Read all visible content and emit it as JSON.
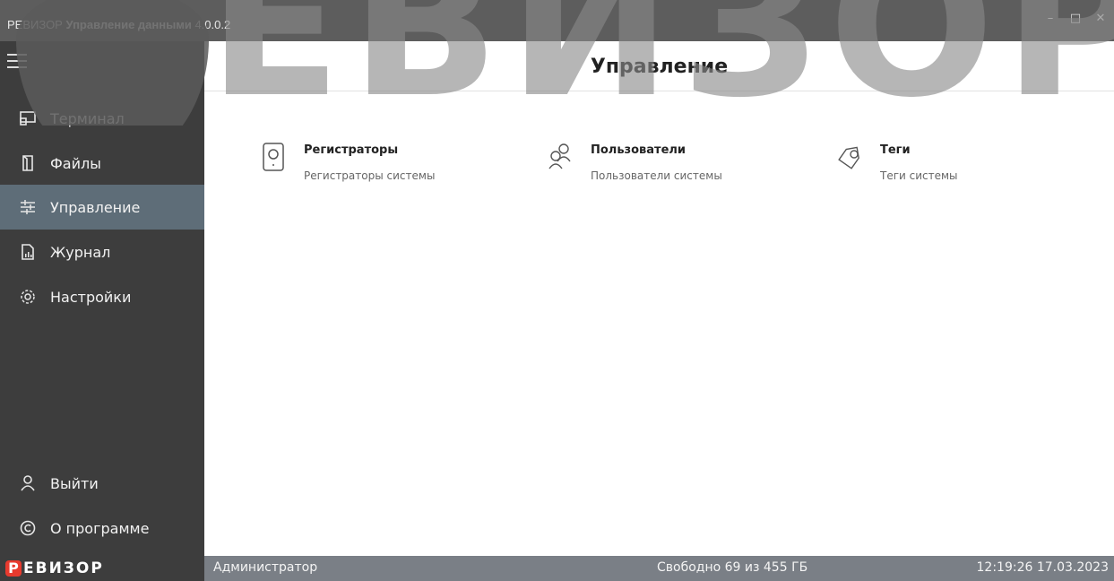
{
  "window": {
    "title_prefix": "РЕВИЗОР",
    "title_main": "Управление данными",
    "version": "4.0.0.2",
    "controls": {
      "minimize": "–",
      "maximize": "□",
      "close": "✕"
    }
  },
  "watermark": {
    "text": "ЕВИЗОР"
  },
  "sidebar": {
    "menu_icon": "hamburger-icon",
    "items": [
      {
        "label": "Терминал",
        "icon": "monitor-icon",
        "active": false
      },
      {
        "label": "Файлы",
        "icon": "file-icon",
        "active": false
      },
      {
        "label": "Управление",
        "icon": "sliders-icon",
        "active": true
      },
      {
        "label": "Журнал",
        "icon": "chart-file-icon",
        "active": false
      },
      {
        "label": "Настройки",
        "icon": "gear-icon",
        "active": false
      }
    ],
    "bottom_items": [
      {
        "label": "Выйти",
        "icon": "user-icon"
      },
      {
        "label": "О программе",
        "icon": "copyright-icon"
      }
    ]
  },
  "header": {
    "title": "Управление"
  },
  "cards": [
    {
      "title": "Регистраторы",
      "subtitle": "Регистраторы системы",
      "icon": "recorder-icon"
    },
    {
      "title": "Пользователи",
      "subtitle": "Пользователи системы",
      "icon": "users-icon"
    },
    {
      "title": "Теги",
      "subtitle": "Теги системы",
      "icon": "tag-icon"
    }
  ],
  "statusbar": {
    "brand_letter": "Р",
    "brand_rest": "ЕВИЗОР",
    "user": "Администратор",
    "free_space": "Свободно 69 из 455 ГБ",
    "datetime": "12:19:26 17.03.2023"
  },
  "colors": {
    "brand_red": "#e83a2e",
    "sidebar_bg": "#3d3d3d",
    "active_bg": "#5e6d78",
    "statusbar_bg": "#7a7f86"
  }
}
